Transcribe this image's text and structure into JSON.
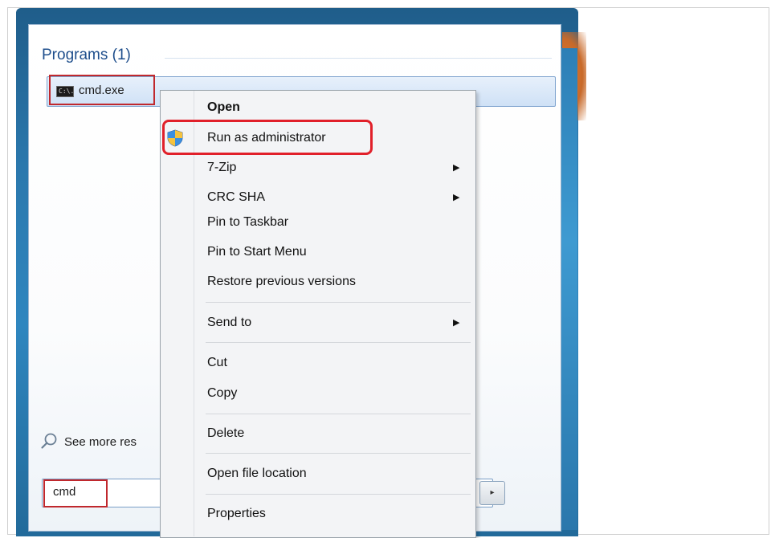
{
  "start_menu": {
    "section_header": "Programs (1)",
    "result": {
      "label": "cmd.exe",
      "icon": "command-prompt-icon",
      "icon_text": "C:\\."
    },
    "see_more_label": "See more res",
    "search": {
      "value": "cmd"
    },
    "shutdown_arrow": "▸"
  },
  "context_menu": {
    "items": [
      {
        "label": "Open",
        "bold": true
      },
      {
        "label": "Run as administrator",
        "icon": "uac-shield-icon",
        "highlighted": true
      },
      {
        "label": "7-Zip",
        "submenu": true
      },
      {
        "label": "CRC SHA",
        "submenu": true
      },
      {
        "label": "Pin to Taskbar"
      },
      {
        "label": "Pin to Start Menu"
      },
      {
        "label": "Restore previous versions"
      },
      {
        "label": "Send to",
        "submenu": true
      },
      {
        "label": "Cut"
      },
      {
        "label": "Copy"
      },
      {
        "label": "Delete"
      },
      {
        "label": "Open file location"
      },
      {
        "label": "Properties"
      }
    ],
    "submenu_arrow": "▶"
  },
  "colors": {
    "highlight_red": "#e1202a",
    "outline_red": "#c0282d",
    "start_menu_blue": "#2b78ad",
    "header_blue": "#1e4e8c"
  }
}
